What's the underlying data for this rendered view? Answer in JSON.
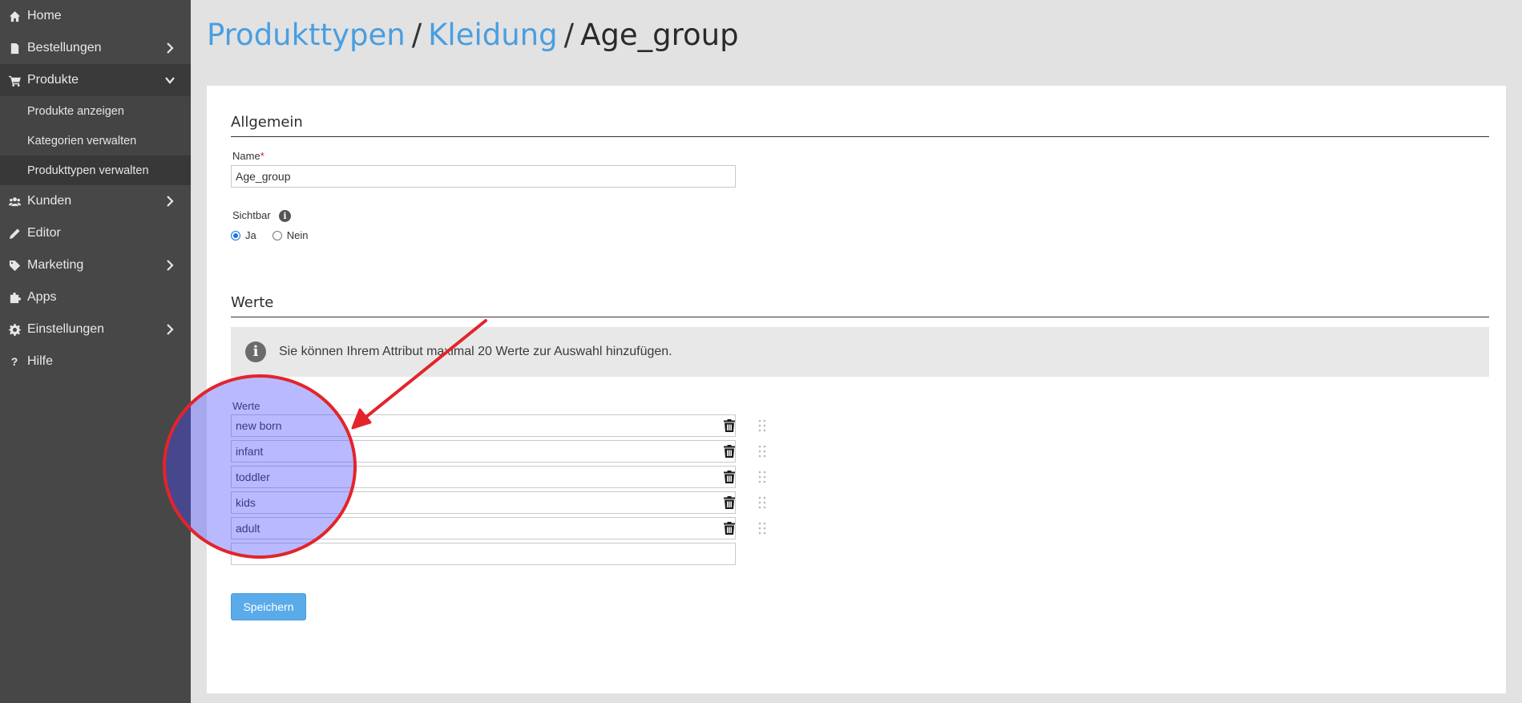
{
  "sidebar": {
    "items": [
      {
        "label": "Home"
      },
      {
        "label": "Bestellungen"
      },
      {
        "label": "Produkte"
      },
      {
        "label": "Kunden"
      },
      {
        "label": "Editor"
      },
      {
        "label": "Marketing"
      },
      {
        "label": "Apps"
      },
      {
        "label": "Einstellungen"
      },
      {
        "label": "Hilfe"
      }
    ],
    "subitems": [
      {
        "label": "Produkte anzeigen"
      },
      {
        "label": "Kategorien verwalten"
      },
      {
        "label": "Produkttypen verwalten"
      }
    ]
  },
  "breadcrumb": {
    "level1": "Produkttypen",
    "level2": "Kleidung",
    "current": "Age_group",
    "separator": "/"
  },
  "general": {
    "title": "Allgemein",
    "name_label": "Name",
    "required_mark": "*",
    "name_value": "Age_group",
    "visible_label": "Sichtbar",
    "radio_yes": "Ja",
    "radio_no": "Nein",
    "selected": "Ja"
  },
  "values_section": {
    "title": "Werte",
    "info_text": "Sie können Ihrem Attribut maximal 20 Werte zur Auswahl hinzufügen.",
    "values_label": "Werte",
    "values": [
      "new born",
      "infant",
      "toddler",
      "kids",
      "adult"
    ],
    "empty_value": ""
  },
  "actions": {
    "save_label": "Speichern"
  },
  "colors": {
    "accent": "#4a9ee0",
    "button": "#5aabea",
    "annotation": "#e3242b",
    "sidebar": "#474747"
  }
}
